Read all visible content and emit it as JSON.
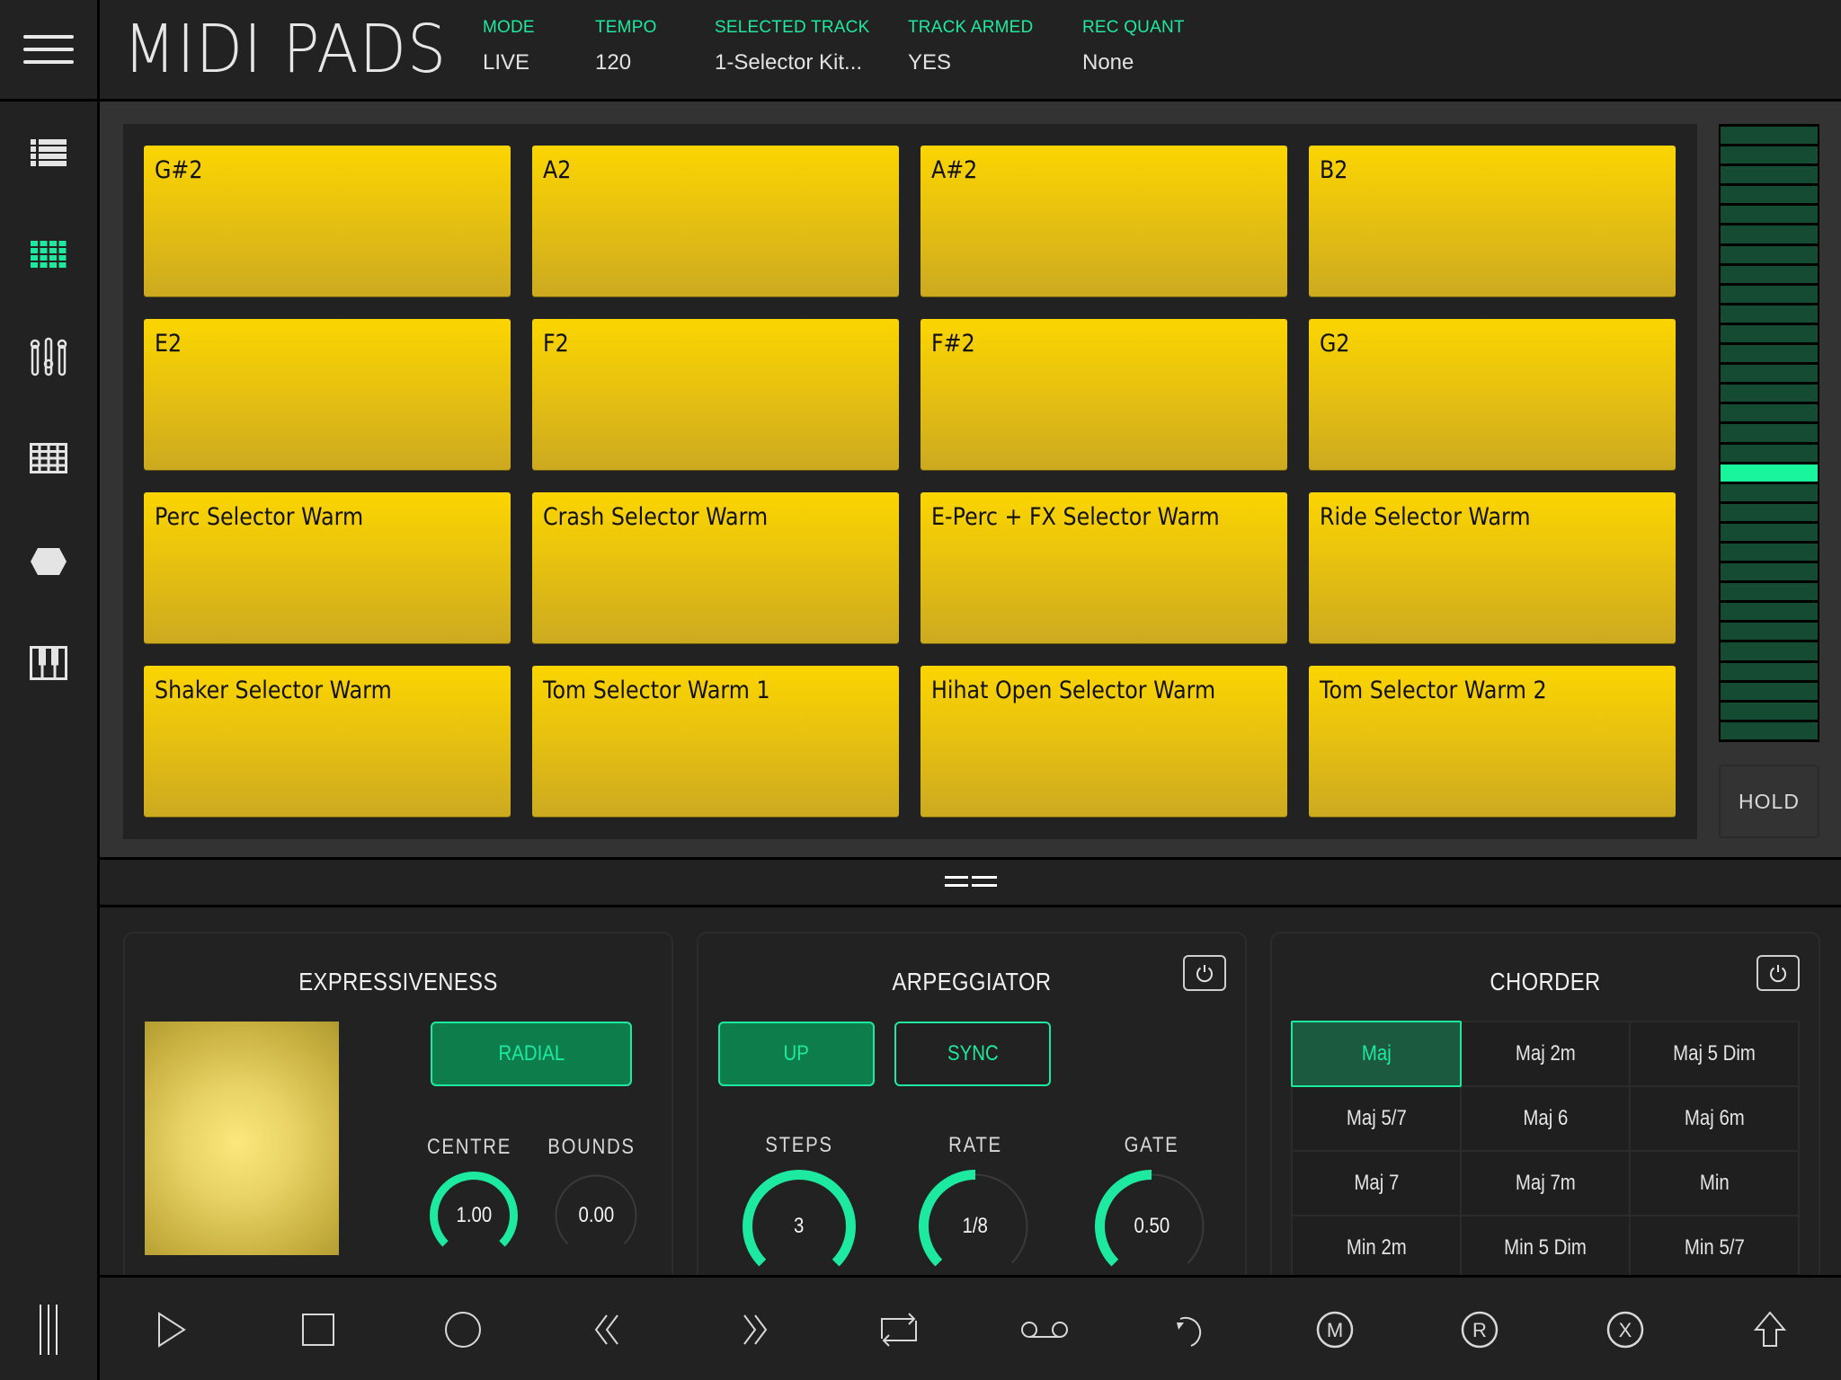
{
  "header": {
    "title": "MIDI PADS",
    "status": [
      {
        "label": "MODE",
        "value": "LIVE"
      },
      {
        "label": "TEMPO",
        "value": "120"
      },
      {
        "label": "SELECTED TRACK",
        "value": "1-Selector Kit..."
      },
      {
        "label": "TRACK ARMED",
        "value": "YES"
      },
      {
        "label": "REC QUANT",
        "value": "None"
      }
    ]
  },
  "sidebar": {
    "items": [
      {
        "icon": "list-icon",
        "active": false
      },
      {
        "icon": "pads-grid-icon",
        "active": true
      },
      {
        "icon": "mixer-sliders-icon",
        "active": false
      },
      {
        "icon": "sequencer-grid-icon",
        "active": false
      },
      {
        "icon": "hexagon-icon",
        "active": false
      },
      {
        "icon": "piano-keys-icon",
        "active": false
      }
    ]
  },
  "pads": [
    [
      "G#2",
      "A2",
      "A#2",
      "B2"
    ],
    [
      "E2",
      "F2",
      "F#2",
      "G2"
    ],
    [
      "Perc Selector Warm",
      "Crash Selector Warm",
      "E-Perc + FX Selector Warm",
      "Ride Selector Warm"
    ],
    [
      "Shaker Selector Warm",
      "Tom Selector Warm  1",
      "Hihat Open Selector Warm",
      "Tom Selector Warm 2"
    ]
  ],
  "meter": {
    "segments": 31,
    "active_index": 17
  },
  "hold_label": "HOLD",
  "expressiveness": {
    "title": "EXPRESSIVENESS",
    "mode_button": "RADIAL",
    "knobs": [
      {
        "label": "CENTRE",
        "value": "1.00",
        "fraction": 1.0
      },
      {
        "label": "BOUNDS",
        "value": "0.00",
        "fraction": 0.0
      }
    ]
  },
  "arpeggiator": {
    "title": "ARPEGGIATOR",
    "buttons": [
      {
        "label": "UP",
        "filled": true
      },
      {
        "label": "SYNC",
        "filled": false
      }
    ],
    "knobs": [
      {
        "label": "STEPS",
        "value": "3",
        "fraction": 1.0
      },
      {
        "label": "RATE",
        "value": "1/8",
        "fraction": 0.5
      },
      {
        "label": "GATE",
        "value": "0.50",
        "fraction": 0.5
      }
    ]
  },
  "chorder": {
    "title": "CHORDER",
    "selected": "Maj",
    "chords": [
      "Maj",
      "Maj 2m",
      "Maj 5 Dim",
      "Maj 5/7",
      "Maj 6",
      "Maj 6m",
      "Maj 7",
      "Maj 7m",
      "Min",
      "Min 2m",
      "Min 5 Dim",
      "Min 5/7"
    ]
  },
  "transport": [
    "play-icon",
    "stop-icon",
    "record-icon",
    "rewind-icon",
    "fast-forward-icon",
    "loop-icon",
    "tape-icon",
    "undo-icon",
    "metronome-m-icon",
    "r-circle-icon",
    "x-circle-icon",
    "shift-arrow-icon"
  ],
  "colors": {
    "accent": "#1de9a0",
    "pad": "#fbd500",
    "background": "#222222",
    "meter_off": "#154a33",
    "meter_on": "#18f59c"
  }
}
